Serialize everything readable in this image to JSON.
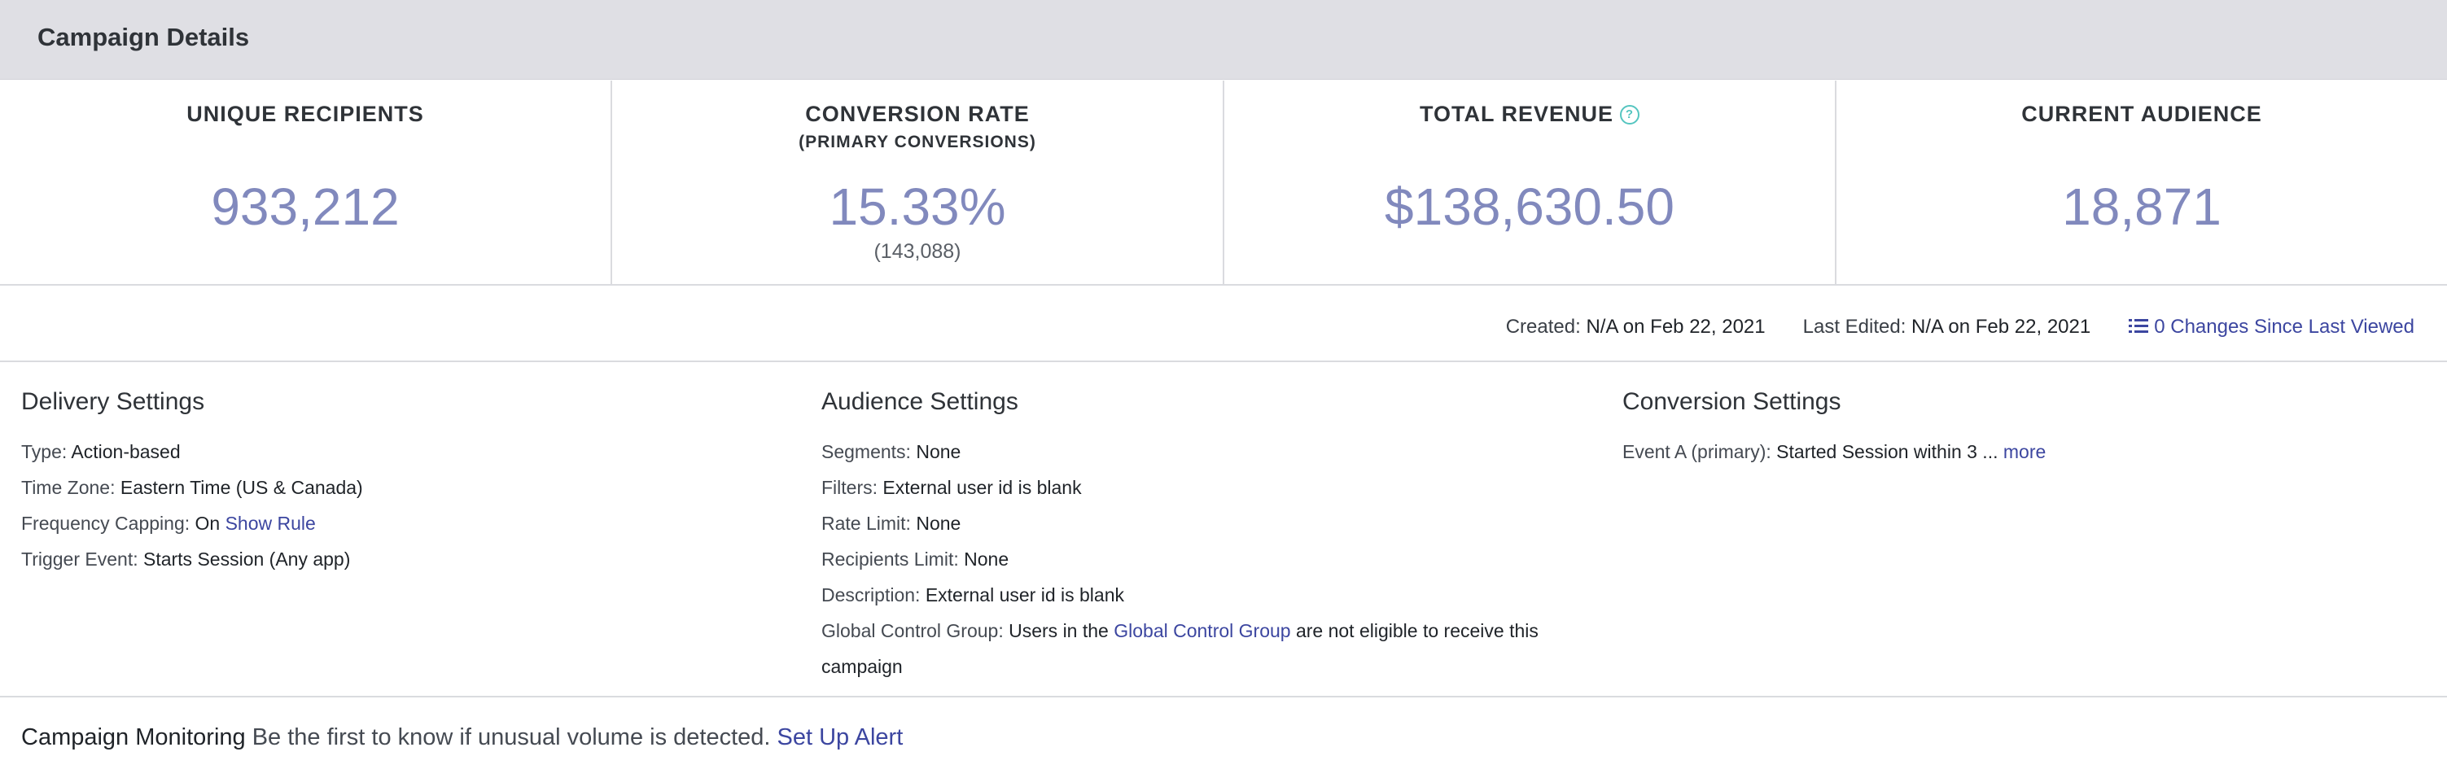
{
  "header": {
    "title": "Campaign Details"
  },
  "stats": [
    {
      "label": "UNIQUE RECIPIENTS",
      "sublabel": "",
      "value": "933,212",
      "subvalue": ""
    },
    {
      "label": "CONVERSION RATE",
      "sublabel": "(PRIMARY CONVERSIONS)",
      "value": "15.33%",
      "subvalue": "(143,088)"
    },
    {
      "label": "TOTAL REVENUE",
      "sublabel": "",
      "value": "$138,630.50",
      "subvalue": "",
      "help_icon": "question-icon"
    },
    {
      "label": "CURRENT AUDIENCE",
      "sublabel": "",
      "value": "18,871",
      "subvalue": ""
    }
  ],
  "meta": {
    "created_label": "Created:",
    "created_value": "N/A on Feb 22, 2021",
    "edited_label": "Last Edited:",
    "edited_value": "N/A on Feb 22, 2021",
    "changes_link": "0 Changes Since Last Viewed",
    "changes_icon": "list-icon"
  },
  "delivery": {
    "title": "Delivery Settings",
    "type_label": "Type:",
    "type_value": "Action-based",
    "tz_label": "Time Zone:",
    "tz_value": "Eastern Time (US & Canada)",
    "freq_label": "Frequency Capping:",
    "freq_value": "On",
    "freq_link": "Show Rule",
    "trigger_label": "Trigger Event:",
    "trigger_value": "Starts Session (Any app)"
  },
  "audience": {
    "title": "Audience Settings",
    "segments_label": "Segments:",
    "segments_value": "None",
    "filters_label": "Filters:",
    "filters_value": "External user id is blank",
    "rate_label": "Rate Limit:",
    "rate_value": "None",
    "recip_label": "Recipients Limit:",
    "recip_value": "None",
    "desc_label": "Description:",
    "desc_value": "External user id is blank",
    "gcg_label": "Global Control Group:",
    "gcg_pre": "Users in the",
    "gcg_link": "Global Control Group",
    "gcg_post": "are not eligible to receive this campaign"
  },
  "conversion": {
    "title": "Conversion Settings",
    "event_label": "Event A (primary):",
    "event_value": "Started Session within 3 ...",
    "more_link": "more"
  },
  "monitoring": {
    "title": "Campaign Monitoring",
    "text": "Be the first to know if unusual volume is detected.",
    "link": "Set Up Alert"
  },
  "colors": {
    "accent": "#8189bd",
    "link": "#3c46a0",
    "help": "#55c5c0",
    "header_bg": "#dfdfe4"
  }
}
